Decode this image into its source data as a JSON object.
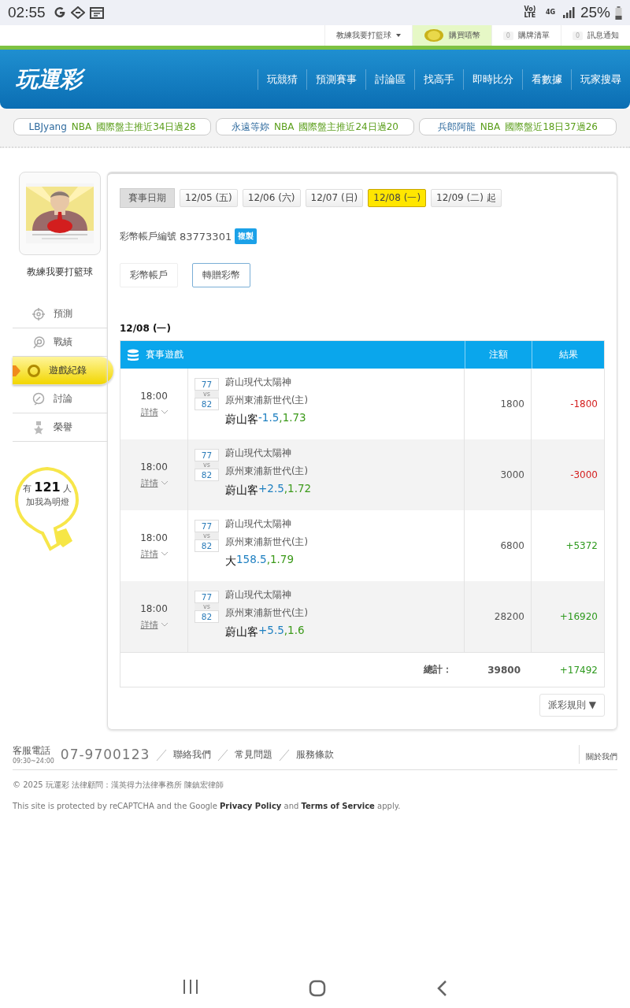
{
  "status_bar": {
    "time": "02:55",
    "volte": "Vo) LTE",
    "network": "4G",
    "battery": "25%"
  },
  "top_links": {
    "user": "教練我要打籃球",
    "buy": "購買嘻幣",
    "cart": {
      "count": "0",
      "label": "購牌清單"
    },
    "messages": {
      "count": "0",
      "label": "訊息通知"
    }
  },
  "header": {
    "logo": "玩運彩",
    "nav": [
      "玩競猜",
      "預測賽事",
      "討論區",
      "找高手",
      "即時比分",
      "看數據",
      "玩家搜尋"
    ]
  },
  "ticker": [
    {
      "user": "LBJyang",
      "league": "NBA",
      "record": "國際盤主推近34日過28"
    },
    {
      "user": "永遠等妳",
      "league": "NBA",
      "record": "國際盤主推近24日過20"
    },
    {
      "user": "兵郎阿龍",
      "league": "NBA",
      "record": "國際盤近18日37過26"
    }
  ],
  "profile": {
    "name": "教練我要打籃球",
    "menu": [
      {
        "label": "預測",
        "selected": false
      },
      {
        "label": "戰績",
        "selected": false
      },
      {
        "label": "遊戲紀錄",
        "selected": true
      },
      {
        "label": "討論",
        "selected": false
      },
      {
        "label": "榮譽",
        "selected": false
      }
    ],
    "fans": {
      "count_text": "有 **121** 人",
      "label": "加我為明燈"
    }
  },
  "dates": {
    "label": "賽事日期",
    "items": [
      {
        "label": "12/05 (五)",
        "selected": false
      },
      {
        "label": "12/06 (六)",
        "selected": false
      },
      {
        "label": "12/07 (日)",
        "selected": false
      },
      {
        "label": "12/08 (一)",
        "selected": true
      },
      {
        "label": "12/09 (二) 起",
        "selected": false
      }
    ]
  },
  "account": {
    "label": "彩幣帳戶編號",
    "number": "83773301",
    "copy": "複製"
  },
  "account_tabs": [
    {
      "label": "彩幣帳戶",
      "selected": false
    },
    {
      "label": "轉贈彩幣",
      "selected": true
    }
  ],
  "day_title": "12/08 (一)",
  "table": {
    "columns": [
      "賽事遊戲",
      "注額",
      "結果"
    ],
    "rows": [
      {
        "time": "18:00",
        "details": "詳情",
        "score_away": "77",
        "vs": "vs",
        "score_home": "82",
        "away": "蔚山現代太陽神",
        "home": "原州東浦新世代(主)",
        "pick": "蔚山客",
        "line": "-1.5",
        "odds": ",1.73",
        "stake": "1800",
        "result": "-1800",
        "color": "#d42020"
      },
      {
        "time": "18:00",
        "details": "詳情",
        "score_away": "77",
        "vs": "vs",
        "score_home": "82",
        "away": "蔚山現代太陽神",
        "home": "原州東浦新世代(主)",
        "pick": "蔚山客",
        "line": "+2.5",
        "odds": ",1.72",
        "stake": "3000",
        "result": "-3000",
        "color": "#d42020"
      },
      {
        "time": "18:00",
        "details": "詳情",
        "score_away": "77",
        "vs": "vs",
        "score_home": "82",
        "away": "蔚山現代太陽神",
        "home": "原州東浦新世代(主)",
        "pick": "大",
        "line": "158.5",
        "odds": ",1.79",
        "stake": "6800",
        "result": "+5372",
        "color": "#2f9a1f"
      },
      {
        "time": "18:00",
        "details": "詳情",
        "score_away": "77",
        "vs": "vs",
        "score_home": "82",
        "away": "蔚山現代太陽神",
        "home": "原州東浦新世代(主)",
        "pick": "蔚山客",
        "line": "+5.5",
        "odds": ",1.6",
        "stake": "28200",
        "result": "+16920",
        "color": "#2f9a1f"
      }
    ],
    "total": {
      "label": "總計：",
      "stake": "39800",
      "result": "+17492",
      "color": "#2f9a1f"
    }
  },
  "rules_button": {
    "label": "派彩規則",
    "caret": "▼"
  },
  "footer": {
    "phone_label": "客服電話",
    "hours": "09:30~24:00",
    "phone": "07-9700123",
    "links": [
      "聯絡我們",
      "常見問題",
      "服務條款"
    ],
    "about": "關於我們",
    "copyright": "© 2025 玩運彩 法律顧問：漢英得力法律事務所 陳鎮宏律師",
    "recaptcha": "This site is protected by reCAPTCHA and the Google **Privacy Policy** and **Terms of Service** apply."
  }
}
